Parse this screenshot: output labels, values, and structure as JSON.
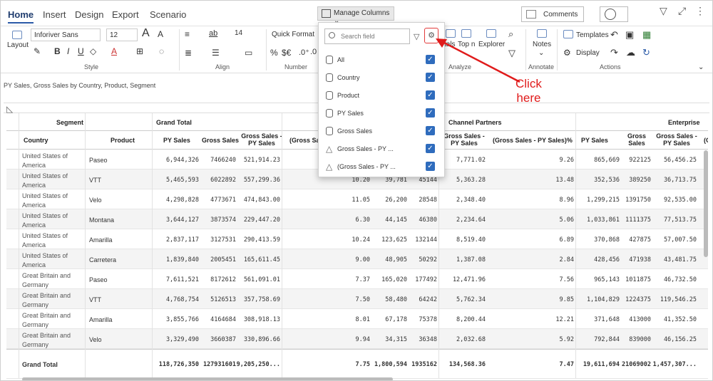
{
  "tabs": [
    "Home",
    "Insert",
    "Design",
    "Export",
    "Scenario"
  ],
  "manage_columns": {
    "label": "Manage Columns",
    "chevron": "⌄",
    "search_placeholder": "Search field",
    "fields": [
      {
        "label": "All",
        "icon": "db"
      },
      {
        "label": "Country",
        "icon": "db"
      },
      {
        "label": "Product",
        "icon": "db"
      },
      {
        "label": "PY Sales",
        "icon": "db"
      },
      {
        "label": "Gross Sales",
        "icon": "db"
      },
      {
        "label": "Gross Sales - PY ...",
        "icon": "tri"
      },
      {
        "label": "(Gross Sales - PY ...",
        "icon": "tri"
      }
    ]
  },
  "topbar": {
    "comments": "Comments",
    "chevron": "⌄"
  },
  "ribbon": {
    "layout": "Layout",
    "font": "Inforiver Sans",
    "size": "12",
    "big_a": "A",
    "small_a": "A",
    "style_group": "Style",
    "align_group": "Align",
    "number_group": "Number",
    "analyze_group": "Analyze",
    "annotate_group": "Annotate",
    "actions_group": "Actions",
    "indent": "14",
    "quick_format": "Quick Format",
    "totals": "tals",
    "topn": "Top n",
    "explorer": "Explorer",
    "notes": "Notes",
    "templates": "Templates",
    "display": "Display",
    "bold": "B",
    "italic": "I",
    "underline": "U",
    "strike": "S",
    "bold_u": "ab",
    "pct": "%",
    "cur": "$€",
    "dec_up": ".0⁺",
    "dec_dn": ".0"
  },
  "report_title": "PY Sales, Gross Sales by Country, Product, Segment",
  "header": {
    "segment": "Segment",
    "grand_total": "Grand Total",
    "channel_partners": "Channel Partners",
    "enterprise": "Enterprise",
    "country": "Country",
    "product": "Product",
    "py_sales": "PY Sales",
    "gross_sales": "Gross Sales",
    "gs_py": "Gross Sales - PY Sales",
    "gs_py_pct": "(Gross Sales - PY Sales)%",
    "gs_py_pct_trunc": "(Gross Sales - PY Sales)%",
    "gs_py_trunc": "(Gross Sales - PY Sales)%"
  },
  "rows": [
    {
      "country": "United States of America",
      "product": "Paseo",
      "py": "6,944,326",
      "gs": "7466240",
      "diff": "521,914.23",
      "a": "",
      "b": "",
      "c": "",
      "cp_diff": "7,771.02",
      "cp_pct": "9.26",
      "e_py": "865,669",
      "e_gs": "922125",
      "e_diff": "56,456.25"
    },
    {
      "country": "United States of America",
      "product": "VTT",
      "py": "5,465,593",
      "gs": "6022892",
      "diff": "557,299.36",
      "a": "10.20",
      "b": "39,781",
      "c": "45144",
      "cp_diff": "5,363.28",
      "cp_pct": "13.48",
      "e_py": "352,536",
      "e_gs": "389250",
      "e_diff": "36,713.75"
    },
    {
      "country": "United States of America",
      "product": "Velo",
      "py": "4,298,828",
      "gs": "4773671",
      "diff": "474,843.00",
      "a": "11.05",
      "b": "26,200",
      "c": "28548",
      "cp_diff": "2,348.40",
      "cp_pct": "8.96",
      "e_py": "1,299,215",
      "e_gs": "1391750",
      "e_diff": "92,535.00"
    },
    {
      "country": "United States of America",
      "product": "Montana",
      "py": "3,644,127",
      "gs": "3873574",
      "diff": "229,447.20",
      "a": "6.30",
      "b": "44,145",
      "c": "46380",
      "cp_diff": "2,234.64",
      "cp_pct": "5.06",
      "e_py": "1,033,861",
      "e_gs": "1111375",
      "e_diff": "77,513.75"
    },
    {
      "country": "United States of America",
      "product": "Amarilla",
      "py": "2,837,117",
      "gs": "3127531",
      "diff": "290,413.59",
      "a": "10.24",
      "b": "123,625",
      "c": "132144",
      "cp_diff": "8,519.40",
      "cp_pct": "6.89",
      "e_py": "370,868",
      "e_gs": "427875",
      "e_diff": "57,007.50"
    },
    {
      "country": "United States of America",
      "product": "Carretera",
      "py": "1,839,840",
      "gs": "2005451",
      "diff": "165,611.45",
      "a": "9.00",
      "b": "48,905",
      "c": "50292",
      "cp_diff": "1,387.08",
      "cp_pct": "2.84",
      "e_py": "428,456",
      "e_gs": "471938",
      "e_diff": "43,481.75"
    },
    {
      "country": "Great Britain and Germany",
      "product": "Paseo",
      "py": "7,611,521",
      "gs": "8172612",
      "diff": "561,091.01",
      "a": "7.37",
      "b": "165,020",
      "c": "177492",
      "cp_diff": "12,471.96",
      "cp_pct": "7.56",
      "e_py": "965,143",
      "e_gs": "1011875",
      "e_diff": "46,732.50"
    },
    {
      "country": "Great Britain and Germany",
      "product": "VTT",
      "py": "4,768,754",
      "gs": "5126513",
      "diff": "357,758.69",
      "a": "7.50",
      "b": "58,480",
      "c": "64242",
      "cp_diff": "5,762.34",
      "cp_pct": "9.85",
      "e_py": "1,104,829",
      "e_gs": "1224375",
      "e_diff": "119,546.25"
    },
    {
      "country": "Great Britain and Germany",
      "product": "Amarilla",
      "py": "3,855,766",
      "gs": "4164684",
      "diff": "308,918.13",
      "a": "8.01",
      "b": "67,178",
      "c": "75378",
      "cp_diff": "8,200.44",
      "cp_pct": "12.21",
      "e_py": "371,648",
      "e_gs": "413000",
      "e_diff": "41,352.50"
    },
    {
      "country": "Great Britain and Germany",
      "product": "Velo",
      "py": "3,329,490",
      "gs": "3660387",
      "diff": "330,896.66",
      "a": "9.94",
      "b": "34,315",
      "c": "36348",
      "cp_diff": "2,032.68",
      "cp_pct": "5.92",
      "e_py": "792,844",
      "e_gs": "839000",
      "e_diff": "46,156.25"
    }
  ],
  "total": {
    "label": "Grand Total",
    "py": "118,726,350",
    "gs": "127931601",
    "diff": "9,205,250...",
    "a": "7.75",
    "b": "1,800,594",
    "c": "1935162",
    "cp_diff": "134,568.36",
    "cp_pct": "7.47",
    "e_py": "19,611,694",
    "e_gs": "21069002",
    "e_diff": "1,457,307..."
  },
  "callout": {
    "line1": "Click",
    "line2": "here"
  },
  "colors": {
    "accent": "#2b5aa8",
    "checkbox": "#2f6cbd",
    "callout": "#e01b1b"
  }
}
